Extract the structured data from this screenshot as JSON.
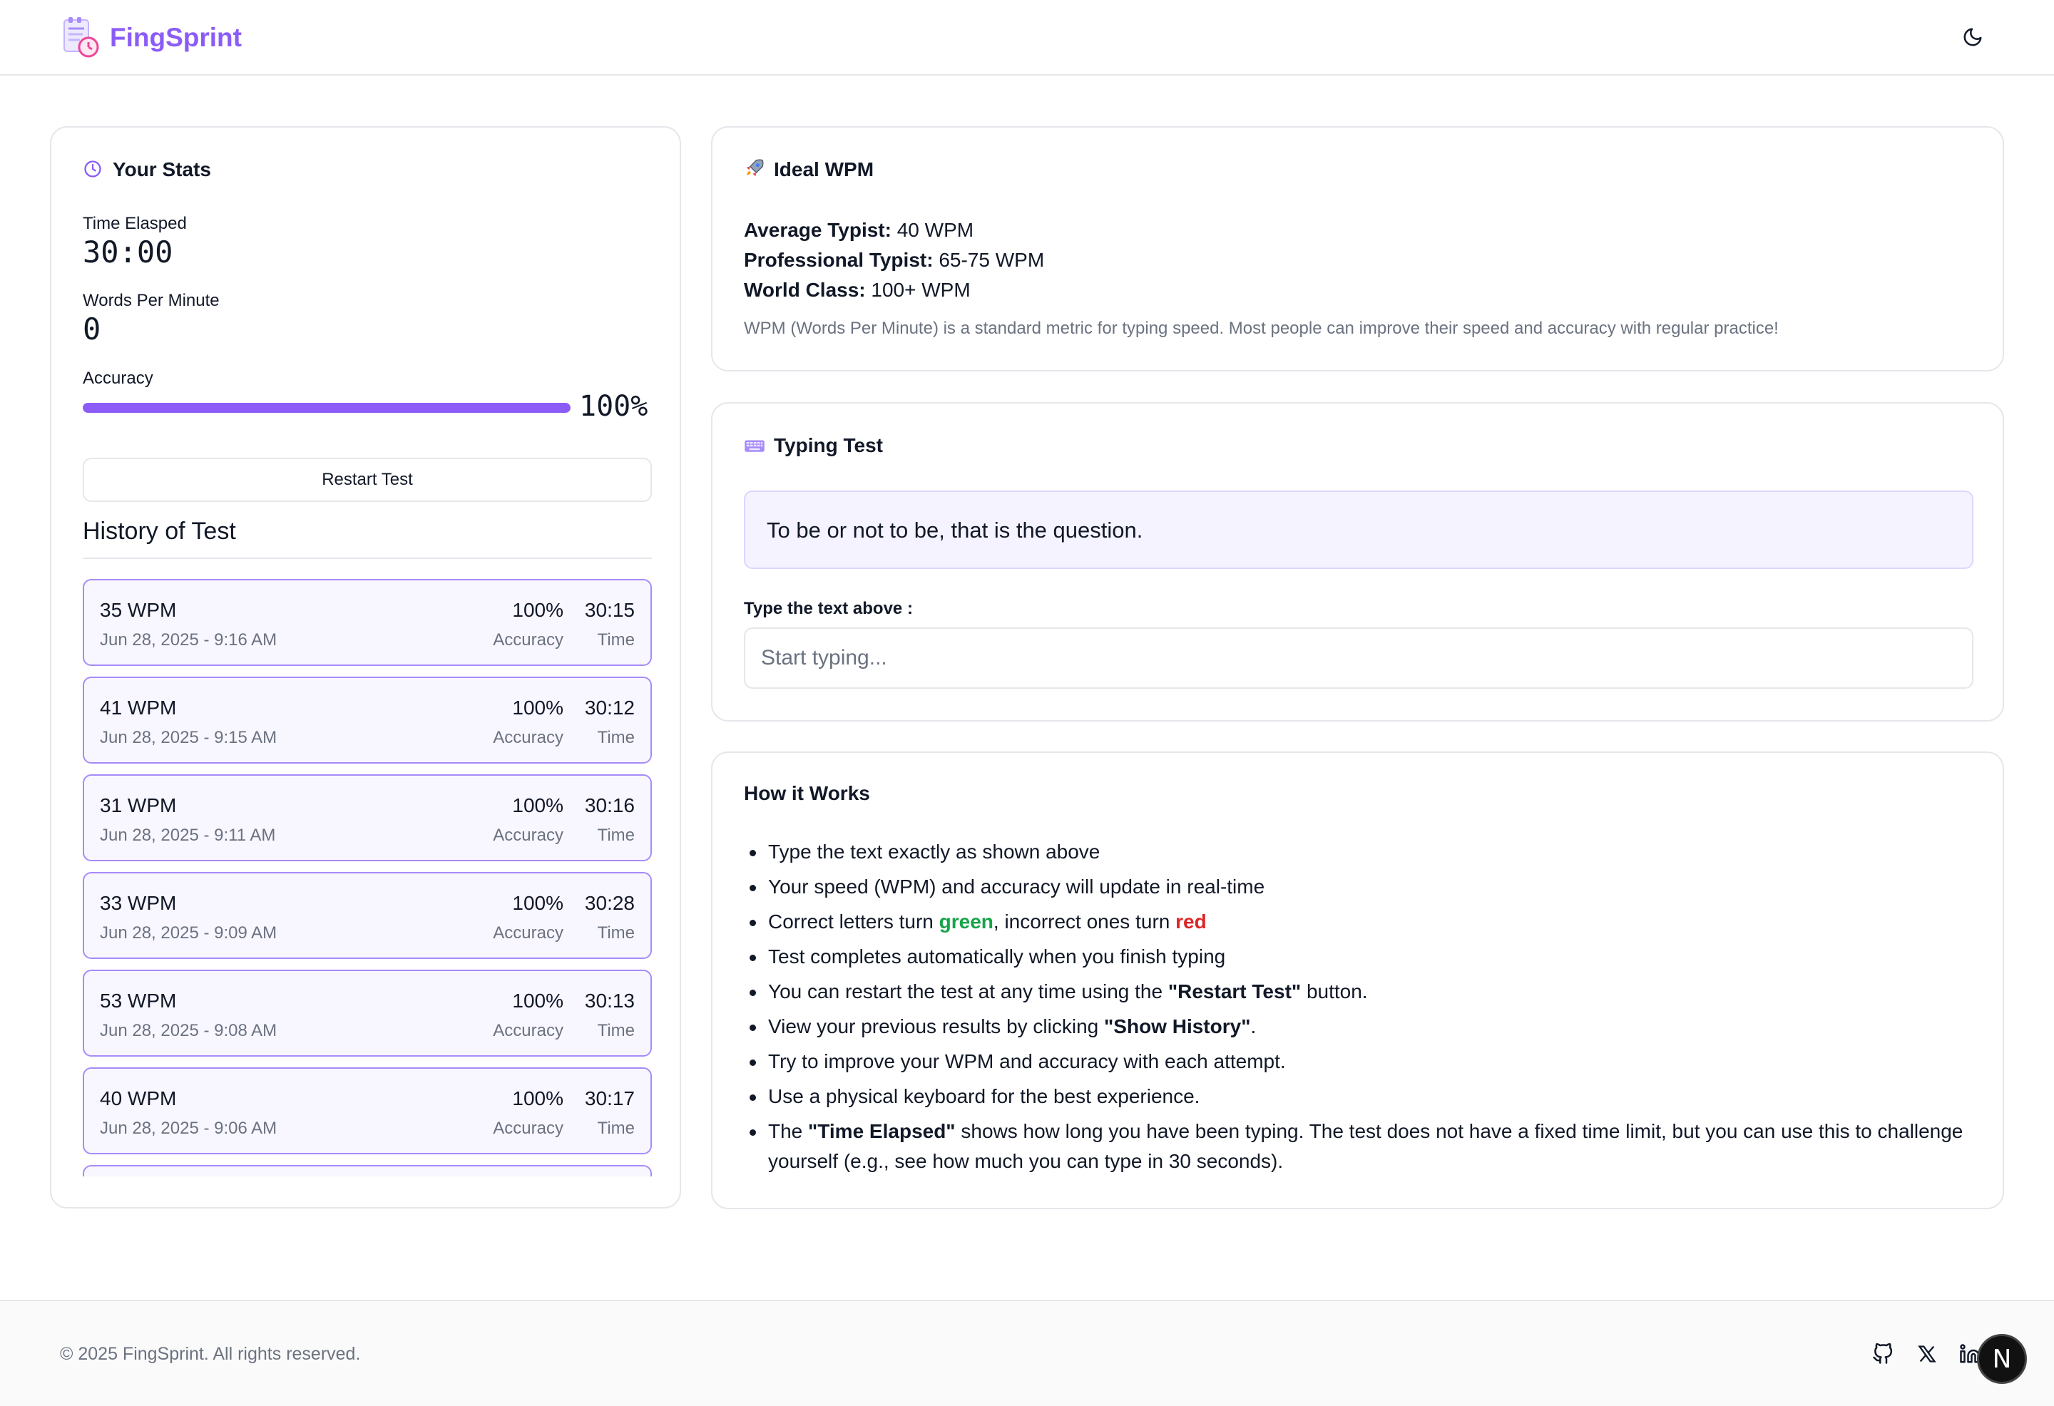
{
  "header": {
    "brand": "FingSprint",
    "logo_icon": "timer-notepad-icon",
    "theme_toggle_icon": "moon-icon"
  },
  "stats": {
    "title": "Your Stats",
    "title_icon": "clock-icon",
    "time_label": "Time Elasped",
    "time_value": "30:00",
    "wpm_label": "Words Per Minute",
    "wpm_value": "0",
    "accuracy_label": "Accuracy",
    "accuracy_value": "100%",
    "accuracy_fraction": 1.0,
    "restart_label": "Restart Test",
    "history_title": "History of Test",
    "history": [
      {
        "wpm": "35 WPM",
        "date": "Jun 28, 2025 - 9:16 AM",
        "accuracy": "100%",
        "accuracy_label": "Accuracy",
        "time": "30:15",
        "time_label": "Time"
      },
      {
        "wpm": "41 WPM",
        "date": "Jun 28, 2025 - 9:15 AM",
        "accuracy": "100%",
        "accuracy_label": "Accuracy",
        "time": "30:12",
        "time_label": "Time"
      },
      {
        "wpm": "31 WPM",
        "date": "Jun 28, 2025 - 9:11 AM",
        "accuracy": "100%",
        "accuracy_label": "Accuracy",
        "time": "30:16",
        "time_label": "Time"
      },
      {
        "wpm": "33 WPM",
        "date": "Jun 28, 2025 - 9:09 AM",
        "accuracy": "100%",
        "accuracy_label": "Accuracy",
        "time": "30:28",
        "time_label": "Time"
      },
      {
        "wpm": "53 WPM",
        "date": "Jun 28, 2025 - 9:08 AM",
        "accuracy": "100%",
        "accuracy_label": "Accuracy",
        "time": "30:13",
        "time_label": "Time"
      },
      {
        "wpm": "40 WPM",
        "date": "Jun 28, 2025 - 9:06 AM",
        "accuracy": "100%",
        "accuracy_label": "Accuracy",
        "time": "30:17",
        "time_label": "Time"
      }
    ]
  },
  "ideal": {
    "title": "Ideal WPM",
    "title_icon": "rocket-icon",
    "average_label": "Average Typist:",
    "average_value": " 40 WPM",
    "professional_label": "Professional Typist:",
    "professional_value": " 65-75 WPM",
    "world_label": "World Class:",
    "world_value": " 100+ WPM",
    "note": "WPM (Words Per Minute) is a standard metric for typing speed. Most people can improve their speed and accuracy with regular practice!"
  },
  "typing": {
    "title": "Typing Test",
    "title_icon": "keyboard-icon",
    "prompt": "To be or not to be, that is the question.",
    "input_label": "Type the text above :",
    "input_placeholder": "Start typing...",
    "input_value": ""
  },
  "how": {
    "title": "How it Works",
    "item1": "Type the text exactly as shown above",
    "item2": "Your speed (WPM) and accuracy will update in real-time",
    "item3_a": "Correct letters turn ",
    "item3_green": "green",
    "item3_b": ", incorrect ones turn ",
    "item3_red": "red",
    "item4": "Test completes automatically when you finish typing",
    "item5_a": "You can restart the test at any time using the ",
    "item5_bold": "\"Restart Test\"",
    "item5_b": " button.",
    "item6_a": "View your previous results by clicking ",
    "item6_bold": "\"Show History\"",
    "item6_b": ".",
    "item7": "Try to improve your WPM and accuracy with each attempt.",
    "item8": "Use a physical keyboard for the best experience.",
    "item9_a": "The ",
    "item9_bold": "\"Time Elapsed\"",
    "item9_b": " shows how long you have been typing. The test does not have a fixed time limit, but you can use this to challenge yourself (e.g., see how much you can type in 30 seconds).",
    "colors": {
      "green": "#16a34a",
      "red": "#dc2626"
    }
  },
  "footer": {
    "copyright": "© 2025 FingSprint. All rights reserved.",
    "icons": [
      "github-icon",
      "x-icon",
      "linkedin-icon"
    ],
    "badge": "N"
  },
  "colors": {
    "accent": "#8b5cf6",
    "accent_light": "#f5f3ff",
    "border": "#e5e7eb",
    "muted": "#6b7280"
  }
}
